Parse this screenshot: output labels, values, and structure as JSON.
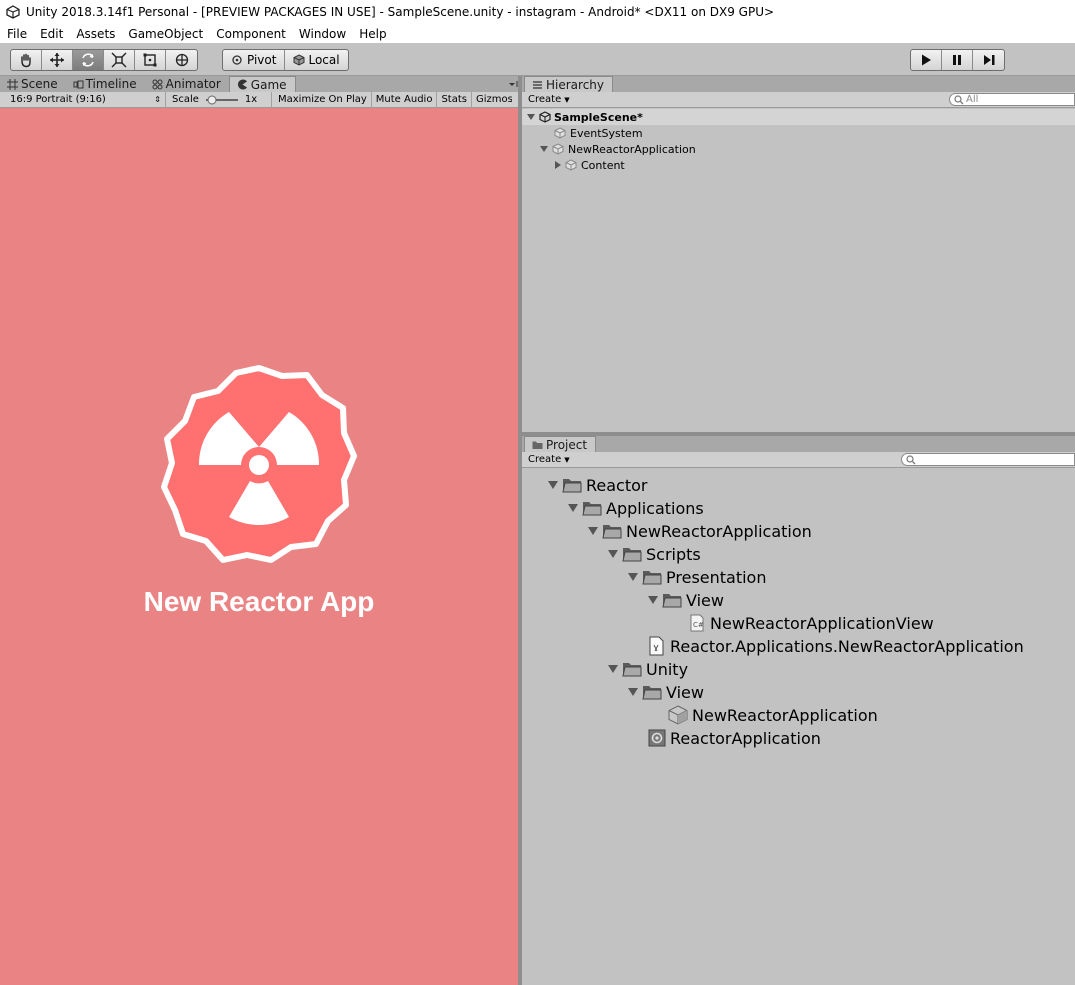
{
  "window": {
    "title": "Unity 2018.3.14f1 Personal - [PREVIEW PACKAGES IN USE] - SampleScene.unity - instagram - Android* <DX11 on DX9 GPU>"
  },
  "menu": [
    "File",
    "Edit",
    "Assets",
    "GameObject",
    "Component",
    "Window",
    "Help"
  ],
  "toolbar": {
    "pivot_label": "Pivot",
    "local_label": "Local"
  },
  "tabs": {
    "scene": "Scene",
    "timeline": "Timeline",
    "animator": "Animator",
    "game": "Game"
  },
  "game_toolbar": {
    "aspect": "16:9 Portrait (9:16)",
    "scale_label": "Scale",
    "scale_value": "1x",
    "maximize": "Maximize On Play",
    "mute": "Mute Audio",
    "stats": "Stats",
    "gizmos": "Gizmos"
  },
  "game_view": {
    "app_title": "New Reactor App",
    "background": "#ea8484",
    "logo_color": "#ff7070"
  },
  "hierarchy": {
    "tab": "Hierarchy",
    "create": "Create",
    "search_placeholder": "All",
    "scene": "SampleScene*",
    "items": [
      "EventSystem",
      "NewReactorApplication",
      "Content"
    ]
  },
  "project": {
    "tab": "Project",
    "create": "Create",
    "tree": [
      "Reactor",
      "Applications",
      "NewReactorApplication",
      "Scripts",
      "Presentation",
      "View",
      "NewReactorApplicationView",
      "Reactor.Applications.NewReactorApplication",
      "Unity",
      "View",
      "NewReactorApplication",
      "ReactorApplication"
    ]
  }
}
